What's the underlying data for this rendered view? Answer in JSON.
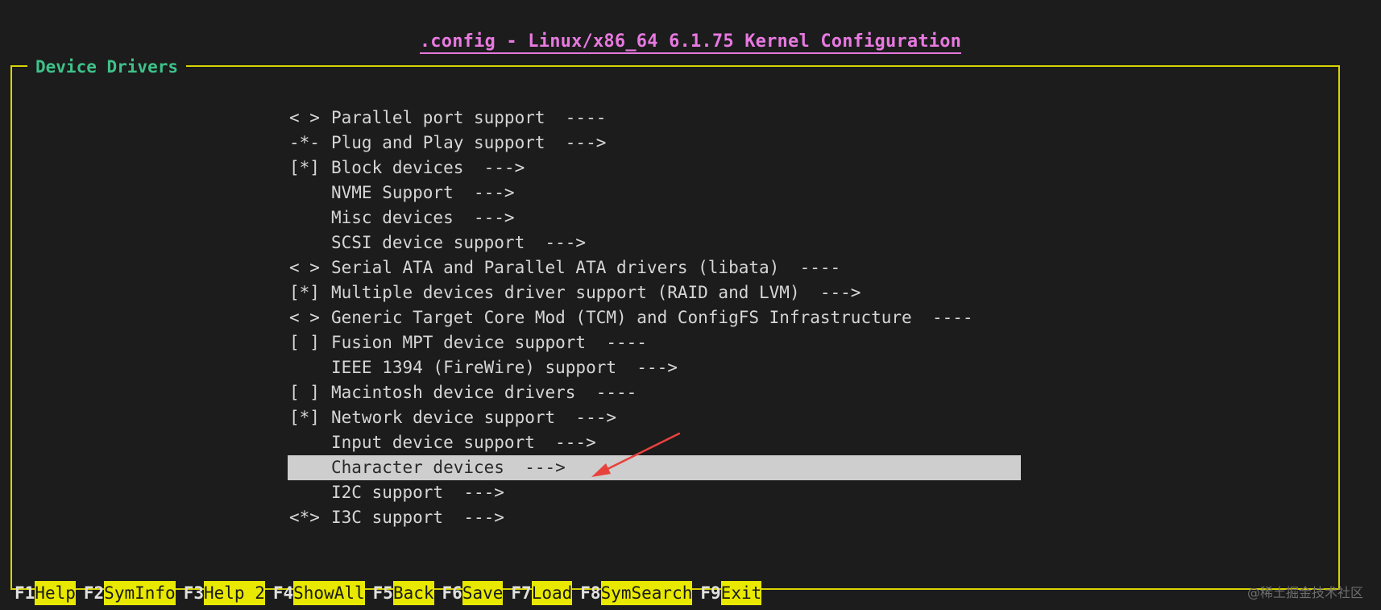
{
  "window": {
    "title": ".config - Linux/x86_64 6.1.75 Kernel Configuration"
  },
  "menu": {
    "title": "Device Drivers",
    "items": [
      {
        "marker": "< >",
        "label": "Parallel port support  ----"
      },
      {
        "marker": "-*-",
        "label": "Plug and Play support  --->"
      },
      {
        "marker": "[*]",
        "label": "Block devices  --->"
      },
      {
        "marker": "",
        "label": "NVME Support  --->"
      },
      {
        "marker": "",
        "label": "Misc devices  --->"
      },
      {
        "marker": "",
        "label": "SCSI device support  --->"
      },
      {
        "marker": "< >",
        "label": "Serial ATA and Parallel ATA drivers (libata)  ----"
      },
      {
        "marker": "[*]",
        "label": "Multiple devices driver support (RAID and LVM)  --->"
      },
      {
        "marker": "< >",
        "label": "Generic Target Core Mod (TCM) and ConfigFS Infrastructure  ----"
      },
      {
        "marker": "[ ]",
        "label": "Fusion MPT device support  ----"
      },
      {
        "marker": "",
        "label": "IEEE 1394 (FireWire) support  --->"
      },
      {
        "marker": "[ ]",
        "label": "Macintosh device drivers  ----"
      },
      {
        "marker": "[*]",
        "label": "Network device support  --->"
      },
      {
        "marker": "",
        "label": "Input device support  --->"
      },
      {
        "marker": "",
        "label": "Character devices  --->",
        "selected": true
      },
      {
        "marker": "",
        "label": "I2C support  --->"
      },
      {
        "marker": "<*>",
        "label": "I3C support  --->"
      }
    ]
  },
  "function_keys": [
    {
      "key": "F1",
      "label": "Help"
    },
    {
      "key": "F2",
      "label": "SymInfo"
    },
    {
      "key": "F3",
      "label": "Help 2"
    },
    {
      "key": "F4",
      "label": "ShowAll"
    },
    {
      "key": "F5",
      "label": "Back"
    },
    {
      "key": "F6",
      "label": "Save"
    },
    {
      "key": "F7",
      "label": "Load"
    },
    {
      "key": "F8",
      "label": "SymSearch"
    },
    {
      "key": "F9",
      "label": "Exit"
    }
  ],
  "annotation": {
    "icon": "red-arrow-icon",
    "color": "#e8413c"
  },
  "watermark": "@稀土掘金技术社区",
  "colors": {
    "background": "#1c1c1c",
    "title": "#e879e0",
    "frame": "#d9d400",
    "menu_title": "#3ec28a",
    "text": "#d6d6d6",
    "selection": "#cecece",
    "fkey_label_bg": "#e8e800"
  }
}
